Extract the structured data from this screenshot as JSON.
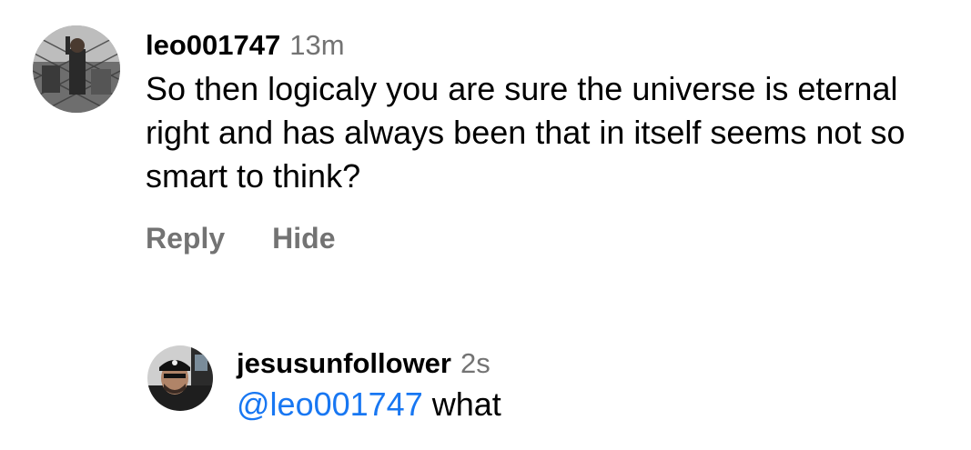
{
  "comments": [
    {
      "username": "leo001747",
      "time": "13m",
      "text": "So then logicaly you are sure the universe is eternal right and has always been that in itself seems not so smart to think?",
      "actions": {
        "reply": "Reply",
        "hide": "Hide"
      }
    }
  ],
  "reply": {
    "username": "jesusunfollower",
    "time": "2s",
    "mention": "@leo001747",
    "text": " what"
  },
  "colors": {
    "muted": "#737373",
    "mention": "#1877f2"
  }
}
